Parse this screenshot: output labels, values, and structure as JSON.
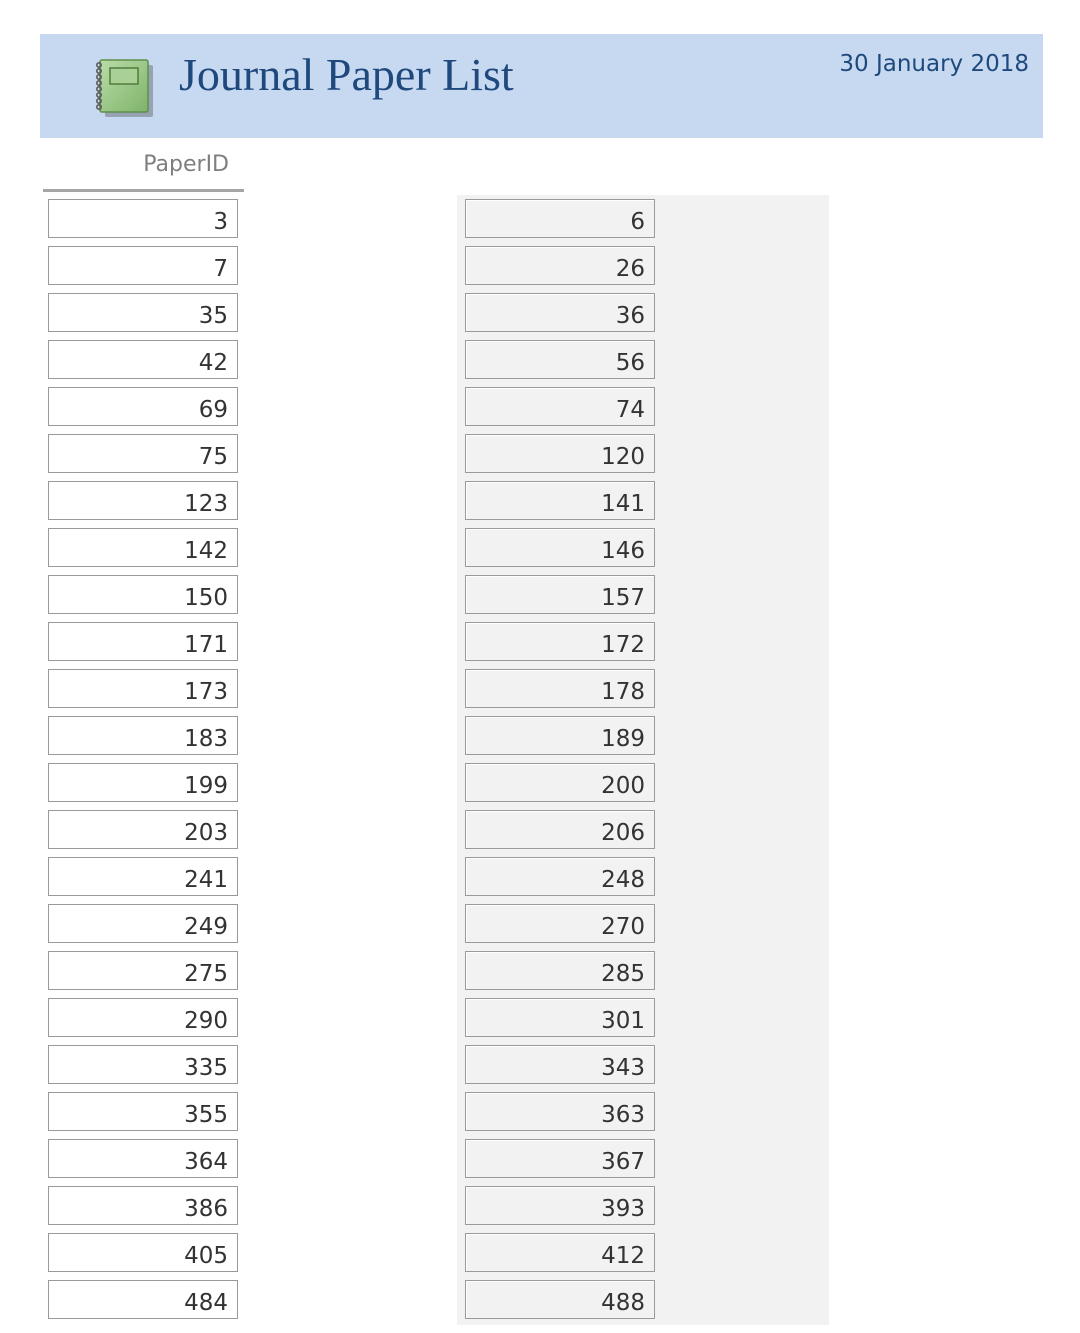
{
  "header": {
    "title": "Journal Paper List",
    "date": "30 January 2018",
    "logo_icon": "notebook-icon",
    "background_color": "#c6d9f1",
    "text_color": "#1f497d"
  },
  "columns": {
    "paper_id_label": "PaperID"
  },
  "records": {
    "left": [
      "3",
      "7",
      "35",
      "42",
      "69",
      "75",
      "123",
      "142",
      "150",
      "171",
      "173",
      "183",
      "199",
      "203",
      "241",
      "249",
      "275",
      "290",
      "335",
      "355",
      "364",
      "386",
      "405",
      "484"
    ],
    "right": [
      "6",
      "26",
      "36",
      "56",
      "74",
      "120",
      "141",
      "146",
      "157",
      "172",
      "178",
      "189",
      "200",
      "206",
      "248",
      "270",
      "285",
      "301",
      "343",
      "363",
      "367",
      "393",
      "412",
      "488"
    ]
  }
}
